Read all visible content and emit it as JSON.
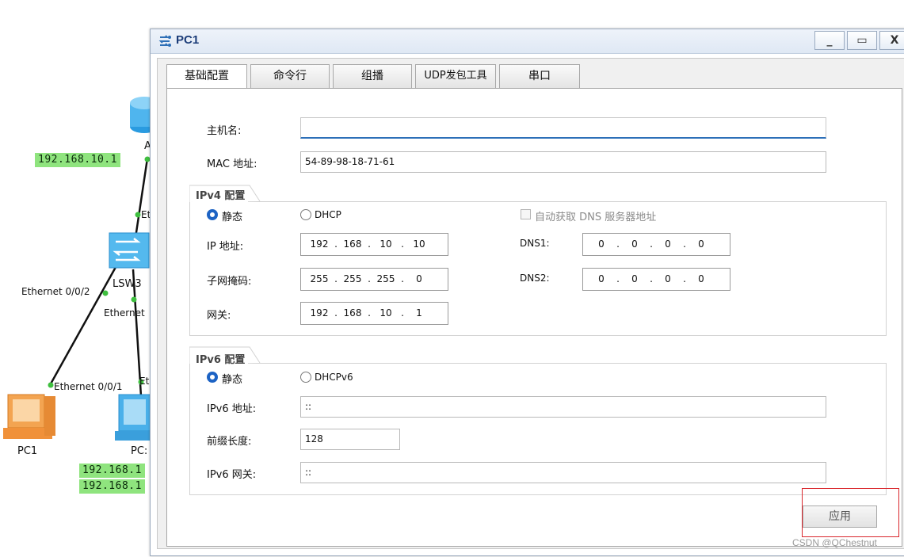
{
  "topology": {
    "ip_tags": [
      "192.168.10.1",
      "192.168.1",
      "192.168.1"
    ],
    "devices": {
      "router_label": "A",
      "switch_label": "LSW3",
      "pc1_label": "PC1",
      "pc2_label": "PC:"
    },
    "link_labels": [
      "Et",
      "Ethernet 0/0/2",
      "Ethernet",
      "Ethernet 0/0/1",
      "Et"
    ]
  },
  "window": {
    "title": "PC1",
    "controls": {
      "minimize": "_",
      "maximize": "▭",
      "close": "X"
    }
  },
  "tabs": [
    {
      "label": "基础配置",
      "active": true
    },
    {
      "label": "命令行",
      "active": false
    },
    {
      "label": "组播",
      "active": false
    },
    {
      "label": "UDP发包工具",
      "active": false
    },
    {
      "label": "串口",
      "active": false
    }
  ],
  "form": {
    "hostname_label": "主机名:",
    "hostname_value": "",
    "mac_label": "MAC 地址:",
    "mac_value": "54-89-98-18-71-61",
    "ipv4": {
      "group_title": "IPv4 配置",
      "static_label": "静态",
      "static_checked": true,
      "dhcp_label": "DHCP",
      "auto_dns_label": "自动获取 DNS 服务器地址",
      "ip_label": "IP 地址:",
      "ip": [
        "192",
        "168",
        "10",
        "10"
      ],
      "mask_label": "子网掩码:",
      "mask": [
        "255",
        "255",
        "255",
        "0"
      ],
      "gateway_label": "网关:",
      "gateway": [
        "192",
        "168",
        "10",
        "1"
      ],
      "dns1_label": "DNS1:",
      "dns1": [
        "0",
        "0",
        "0",
        "0"
      ],
      "dns2_label": "DNS2:",
      "dns2": [
        "0",
        "0",
        "0",
        "0"
      ]
    },
    "ipv6": {
      "group_title": "IPv6 配置",
      "static_label": "静态",
      "static_checked": true,
      "dhcpv6_label": "DHCPv6",
      "addr_label": "IPv6 地址:",
      "addr_value": "::",
      "prefix_label": "前缀长度:",
      "prefix_value": "128",
      "gateway_label": "IPv6 网关:",
      "gateway_value": "::"
    },
    "apply_label": "应用"
  },
  "watermark": "CSDN @QChestnut",
  "colors": {
    "ip_tag_bg": "#8fe47e",
    "accent_blue": "#1d63c4",
    "highlight_red": "#d9262c"
  }
}
